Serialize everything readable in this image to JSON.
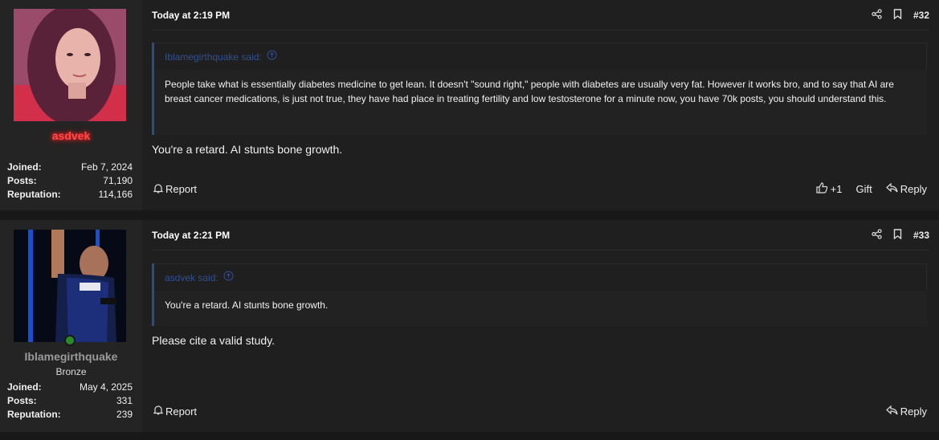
{
  "posts": [
    {
      "username": "asdvek",
      "user_title": "",
      "stats": [
        {
          "label": "Joined:",
          "value": "Feb 7, 2024"
        },
        {
          "label": "Posts:",
          "value": "71,190"
        },
        {
          "label": "Reputation:",
          "value": "114,166"
        }
      ],
      "date": "Today at 2:19 PM",
      "number": "#32",
      "quote_author": "Iblamegirthquake said:",
      "quote_text": "People take what is essentially diabetes medicine to get lean. It doesn't \"sound right,\" people with diabetes are usually very fat. However it works bro, and to say that AI are breast cancer medications, is just not true, they have had place in treating fertility and low testosterone for a minute now, you have 70k posts, you should understand this.",
      "message": "You're a retard. AI stunts bone growth.",
      "report_label": "Report",
      "like_count": "+1",
      "gift_label": "Gift",
      "reply_label": "Reply"
    },
    {
      "username": "Iblamegirthquake",
      "user_title": "Bronze",
      "stats": [
        {
          "label": "Joined:",
          "value": "May 4, 2025"
        },
        {
          "label": "Posts:",
          "value": "331"
        },
        {
          "label": "Reputation:",
          "value": "239"
        }
      ],
      "date": "Today at 2:21 PM",
      "number": "#33",
      "quote_author": "asdvek said:",
      "quote_text": "You're a retard. AI stunts bone growth.",
      "message": "Please cite a valid study.",
      "report_label": "Report",
      "reply_label": "Reply"
    }
  ],
  "colors": {
    "background": "#181818",
    "post_bg": "#1f1f1f",
    "user_col_bg": "#242424",
    "quote_accent": "#2f4a8a",
    "username_red": "#ff4a4a",
    "username_gray": "#9a9a9a"
  }
}
